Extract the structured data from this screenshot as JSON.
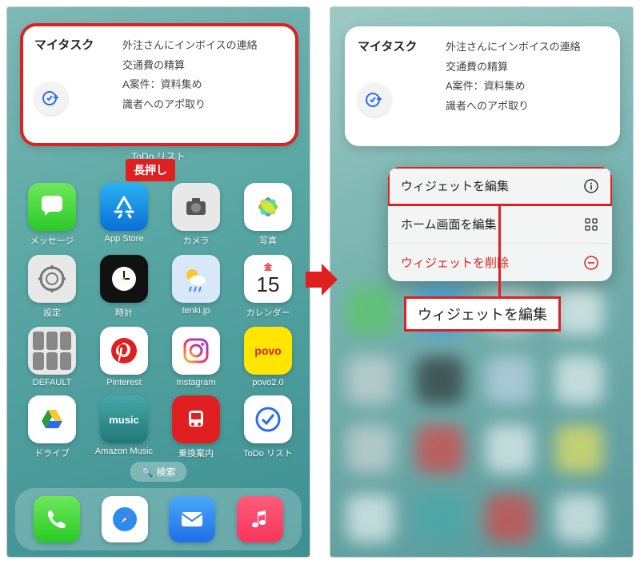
{
  "widget": {
    "title": "マイタスク",
    "items": [
      "外注さんにインボイスの連絡",
      "交通費の精算",
      "A案件：資料集め",
      "識者へのアポ取り"
    ],
    "app_label": "ToDo リスト"
  },
  "annotations": {
    "long_press": "長押し",
    "callout": "ウィジェットを編集"
  },
  "apps": {
    "row": [
      {
        "label": "メッセージ"
      },
      {
        "label": "App Store"
      },
      {
        "label": "カメラ"
      },
      {
        "label": "写真"
      },
      {
        "label": "設定"
      },
      {
        "label": "時計"
      },
      {
        "label": "tenki.jp"
      },
      {
        "label": "カレンダー"
      },
      {
        "label": "DEFAULT"
      },
      {
        "label": "Pinterest"
      },
      {
        "label": "Instagram"
      },
      {
        "label": "povo2.0"
      },
      {
        "label": "ドライブ"
      },
      {
        "label": "Amazon Music"
      },
      {
        "label": "乗換案内"
      },
      {
        "label": "ToDo リスト"
      }
    ],
    "calendar_day_label": "金",
    "calendar_day_num": "15",
    "povo_text": "povo",
    "music_text": "music",
    "search": "検索"
  },
  "context_menu": {
    "edit_widget": "ウィジェットを編集",
    "edit_home": "ホーム画面を編集",
    "remove_widget": "ウィジェットを削除"
  }
}
